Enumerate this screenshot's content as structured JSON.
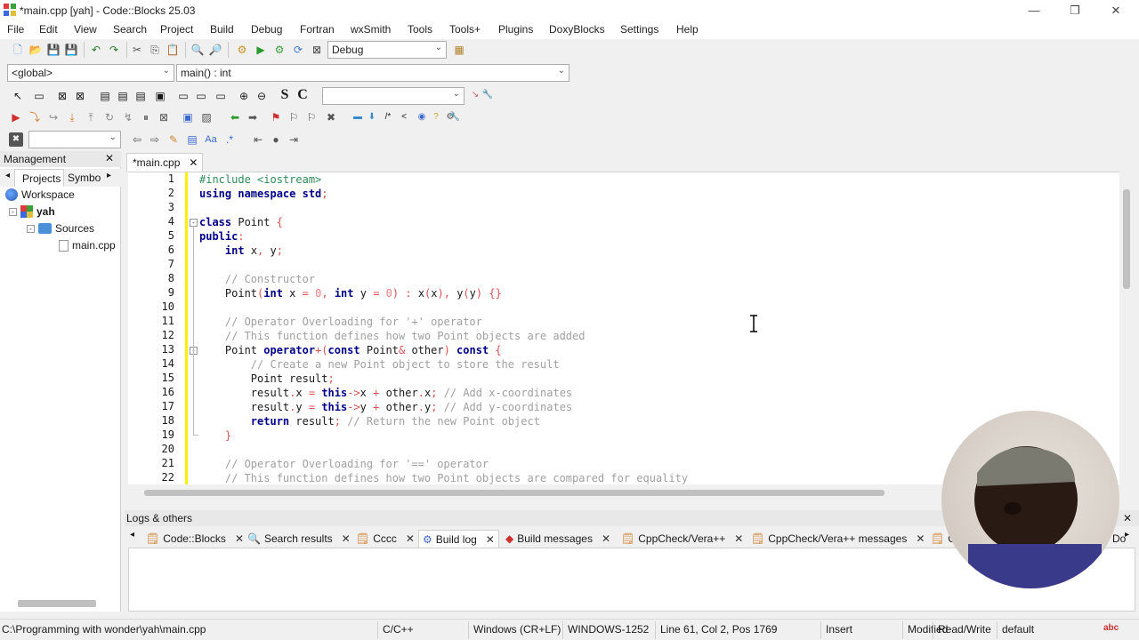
{
  "window": {
    "title": "*main.cpp [yah] - Code::Blocks 25.03",
    "minimize": "—",
    "restore": "❐",
    "close": "✕"
  },
  "menu": [
    "File",
    "Edit",
    "View",
    "Search",
    "Project",
    "Build",
    "Debug",
    "Fortran",
    "wxSmith",
    "Tools",
    "Tools+",
    "Plugins",
    "DoxyBlocks",
    "Settings",
    "Help"
  ],
  "toolbar": {
    "build_target": "Debug",
    "scope": "<global>",
    "function": "main() : int",
    "search_value": ""
  },
  "management": {
    "title": "Management",
    "tabs": [
      "Projects",
      "Symbo"
    ],
    "tree": {
      "workspace": "Workspace",
      "project": "yah",
      "folder": "Sources",
      "file": "main.cpp"
    }
  },
  "editor": {
    "tab_label": "*main.cpp",
    "line_numbers": [
      "1",
      "2",
      "3",
      "4",
      "5",
      "6",
      "7",
      "8",
      "9",
      "10",
      "11",
      "12",
      "13",
      "14",
      "15",
      "16",
      "17",
      "18",
      "19",
      "20",
      "21",
      "22"
    ]
  },
  "logs": {
    "title": "Logs & others",
    "tabs": [
      "Code::Blocks",
      "Search results",
      "Cccc",
      "Build log",
      "Build messages",
      "CppCheck/Vera++",
      "CppCheck/Vera++ messages",
      "C",
      "Do"
    ]
  },
  "status": {
    "path": "C:\\Programming with wonder\\yah\\main.cpp",
    "language": "C/C++",
    "eol": "Windows (CR+LF)",
    "encoding": "WINDOWS-1252",
    "position": "Line 61, Col 2, Pos 1769",
    "mode": "Insert",
    "modified": "Modified",
    "access": "Read/Write",
    "profile": "default"
  },
  "colors": {
    "keyword": "#00008b",
    "comment": "#a0a0a0",
    "preprocessor": "#2e8b57",
    "number": "#f08080",
    "changebar": "#fff200"
  }
}
